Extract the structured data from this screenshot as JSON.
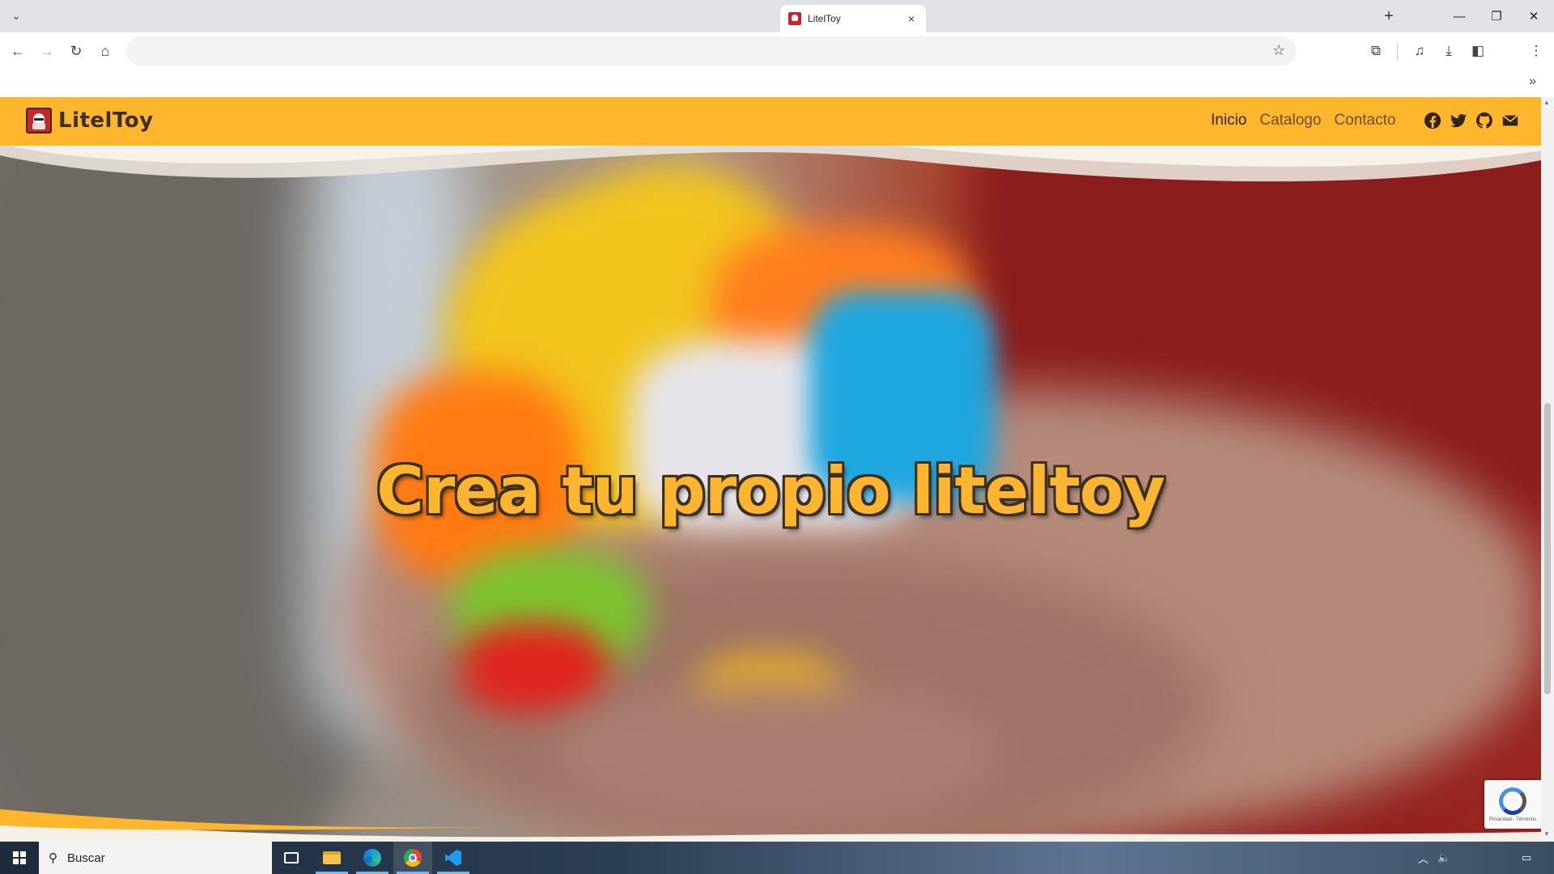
{
  "browser": {
    "tab_title": "LitelToy",
    "tab_close": "×",
    "new_tab": "+",
    "address_value": "",
    "controls": {
      "minimize": "—",
      "restore": "❐",
      "close": "✕"
    },
    "bookmarks_more": "»"
  },
  "site": {
    "brand_name": "LitelToy",
    "nav": [
      {
        "label": "Inicio"
      },
      {
        "label": "Catalogo"
      },
      {
        "label": "Contacto"
      }
    ],
    "social": [
      "facebook-icon",
      "twitter-icon",
      "github-icon",
      "envelope-icon"
    ],
    "hero_title": "Crea tu propio liteltoy",
    "accent_color": "#ffb62c",
    "recaptcha_text": "Privacidad - Términos"
  },
  "taskbar": {
    "search_placeholder": "Buscar",
    "apps": [
      "task-view-icon",
      "file-explorer-icon",
      "edge-icon",
      "chrome-icon",
      "vscode-icon"
    ]
  }
}
